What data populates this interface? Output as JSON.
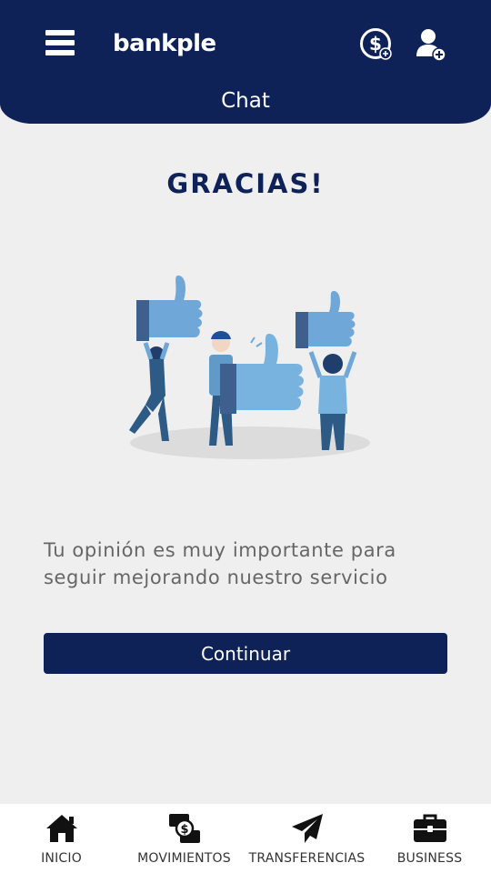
{
  "header": {
    "logo_text": "bankple",
    "title": "Chat",
    "icons": [
      "menu-icon",
      "dollar-add-icon",
      "user-add-icon"
    ]
  },
  "main": {
    "heading": "GRACIAS!",
    "message": "Tu opinión es muy importante para seguir mejorando nuestro servicio",
    "continue_label": "Continuar"
  },
  "nav": {
    "items": [
      {
        "label": "INICIO",
        "icon": "home-icon"
      },
      {
        "label": "MOVIMIENTOS",
        "icon": "money-exchange-icon"
      },
      {
        "label": "TRANSFERENCIAS",
        "icon": "paper-plane-icon"
      },
      {
        "label": "BUSINESS",
        "icon": "briefcase-icon"
      }
    ]
  },
  "colors": {
    "primary": "#0e2258",
    "background": "#efefef",
    "illustration_blue": "#78b3e0"
  }
}
